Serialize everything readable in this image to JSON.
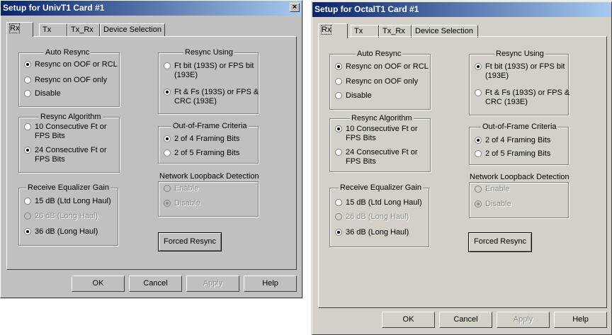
{
  "colors": {
    "left_title_gradient": [
      "#0a246a",
      "#a6caf0"
    ],
    "right_title_gradient": [
      "#0a246a",
      "#a6caf0"
    ],
    "left_face": "#c0c0c0",
    "right_face": "#d4d0c8"
  },
  "left": {
    "title": "Setup for UnivT1 Card #1",
    "close_icon": "×",
    "tabs": [
      "Rx",
      "Tx",
      "Tx_Rx",
      "Device Selection"
    ],
    "auto_resync": {
      "caption": "Auto Resync",
      "options": [
        "Resync on OOF or RCL",
        "Resync on OOF only",
        "Disable"
      ],
      "selected": 0
    },
    "resync_algorithm": {
      "caption": "Resync Algorithm",
      "options": [
        "10 Consecutive Ft or\nFPS Bits",
        "24 Consecutive Ft or\nFPS Bits"
      ],
      "selected": 1
    },
    "receive_eq_gain": {
      "caption": "Receive Equalizer Gain",
      "options": [
        "15 dB (Ltd Long Haul)",
        "26 dB (Long Haul)",
        "36 dB (Long Haul)"
      ],
      "selected": 2,
      "disabled": [
        1
      ]
    },
    "resync_using": {
      "caption": "Resync Using",
      "options": [
        "Ft bit (193S) or FPS bit\n(193E)",
        "Ft & Fs (193S) or FPS &\nCRC (193E)"
      ],
      "selected": 1
    },
    "oof_criteria": {
      "caption": "Out-of-Frame Criteria",
      "options": [
        "2 of 4 Framing Bits",
        "2 of 5 Framing Bits"
      ],
      "selected": 0
    },
    "loopback": {
      "caption": "Network Loopback Detection",
      "options": [
        "Enable",
        "Disable"
      ],
      "selected": 1,
      "disabled": [
        0,
        1
      ]
    },
    "forced_resync": "Forced Resync",
    "buttons": {
      "ok": "OK",
      "cancel": "Cancel",
      "apply": "Apply",
      "help": "Help"
    }
  },
  "right": {
    "title": "Setup for OctalT1 Card #1",
    "tabs": [
      "Rx",
      "Tx",
      "Tx_Rx",
      "Device Selection"
    ],
    "auto_resync": {
      "caption": "Auto Resync",
      "options": [
        "Resync on OOF or RCL",
        "Resync on OOF only",
        "Disable"
      ],
      "selected": 0
    },
    "resync_algorithm": {
      "caption": "Resync Algorithm",
      "options": [
        "10 Consecutive Ft or\nFPS Bits",
        "24 Consecutive Ft or\nFPS Bits"
      ],
      "selected": 0
    },
    "receive_eq_gain": {
      "caption": "Receive Equalizer Gain",
      "options": [
        "15 dB (Ltd Long Haul)",
        "26 dB (Long Haul)",
        "36 dB (Long Haul)"
      ],
      "selected": 2,
      "disabled": [
        1
      ]
    },
    "resync_using": {
      "caption": "Resync Using",
      "options": [
        "Ft bit (193S) or FPS bit\n(193E)",
        "Ft & Fs (193S) or FPS &\nCRC (193E)"
      ],
      "selected": 0
    },
    "oof_criteria": {
      "caption": "Out-of-Frame Criteria",
      "options": [
        "2 of 4 Framing Bits",
        "2 of 5 Framing Bits"
      ],
      "selected": 0
    },
    "loopback": {
      "caption": "Network Loopback Detection",
      "options": [
        "Enable",
        "Disable"
      ],
      "selected": 1,
      "disabled": [
        0,
        1
      ]
    },
    "forced_resync": "Forced Resync",
    "buttons": {
      "ok": "OK",
      "cancel": "Cancel",
      "apply": "Apply",
      "help": "Help"
    }
  }
}
